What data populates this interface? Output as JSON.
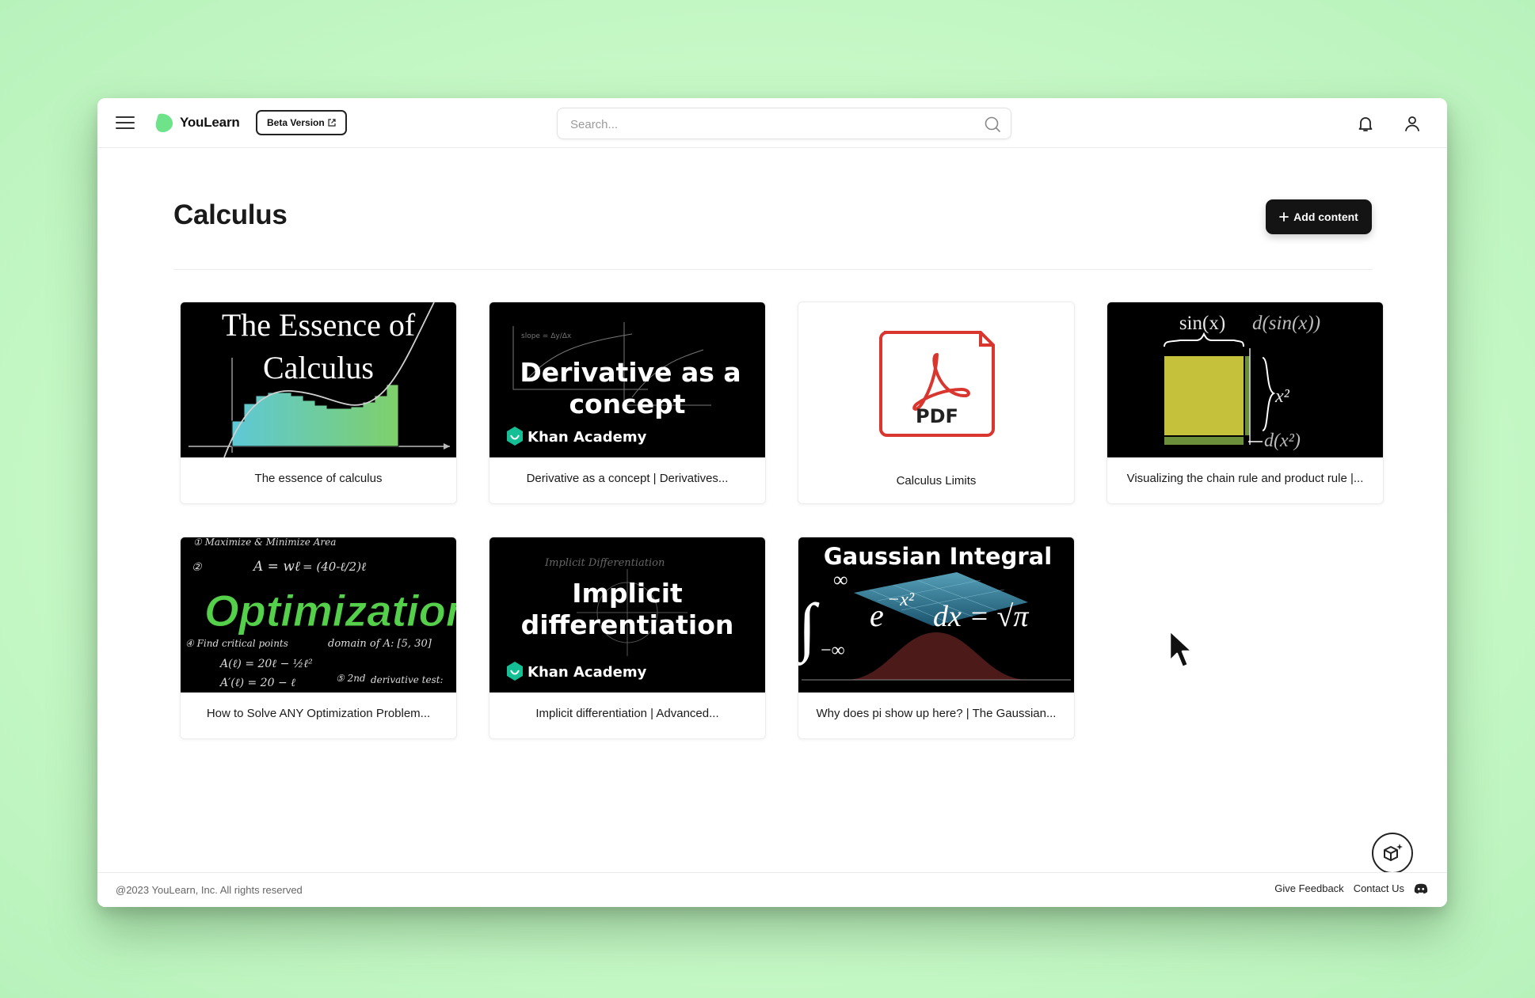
{
  "app": {
    "logo_text": "YouLearn",
    "beta_label": "Beta Version"
  },
  "search": {
    "placeholder": "Search..."
  },
  "page": {
    "title": "Calculus",
    "add_button_label": "Add content"
  },
  "cards": [
    {
      "caption": "The essence of calculus",
      "thumb_text": [
        "The Essence of",
        "Calculus"
      ]
    },
    {
      "caption": "Derivative as a concept | Derivatives...",
      "thumb_text": [
        "Derivative as a",
        "concept"
      ],
      "brand": "Khan Academy"
    },
    {
      "caption": "Calculus Limits",
      "thumb_text": [
        "PDF"
      ]
    },
    {
      "caption": "Visualizing the chain rule and product rule |...",
      "thumb_text": [
        "sin(x)",
        "d(sin(x))",
        "x²",
        "d(x²)"
      ]
    },
    {
      "caption": "How to Solve ANY Optimization Problem...",
      "thumb_text": [
        "Optimization",
        "A = wℓ",
        "domain of A: [5, 30]",
        "derivative test:"
      ]
    },
    {
      "caption": "Implicit differentiation | Advanced...",
      "thumb_text": [
        "Implicit",
        "differentiation"
      ],
      "brand": "Khan Academy"
    },
    {
      "caption": "Why does pi show up here? | The Gaussian...",
      "thumb_text": [
        "Gaussian Integral",
        "e",
        "−x²",
        "dx = √π",
        "∞",
        "−∞"
      ]
    }
  ],
  "footer": {
    "copyright": "@2023 YouLearn, Inc. All rights reserved",
    "feedback": "Give Feedback",
    "contact": "Contact Us"
  },
  "colors": {
    "background": "#c6f8c6",
    "logo_green": "#6fe38a",
    "pdf_red": "#d8362f",
    "primary_button": "#141414"
  },
  "icons": [
    "menu-icon",
    "logo-icon",
    "external-link-icon",
    "search-icon",
    "bell-icon",
    "user-icon",
    "plus-icon",
    "ai-assistant-icon",
    "discord-icon",
    "pointer-cursor-icon"
  ]
}
